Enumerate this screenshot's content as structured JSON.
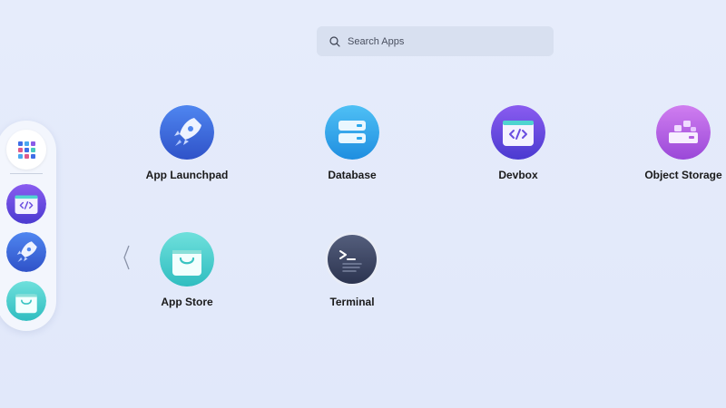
{
  "search": {
    "placeholder": "Search Apps",
    "icon": "search-icon"
  },
  "dock": {
    "items": [
      {
        "name": "all-apps",
        "icon": "grid-icon"
      },
      {
        "name": "Devbox",
        "icon": "devbox-icon"
      },
      {
        "name": "App Launchpad",
        "icon": "rocket-icon"
      },
      {
        "name": "App Store",
        "icon": "shopping-bag-icon"
      }
    ]
  },
  "apps": [
    {
      "label": "App Launchpad",
      "icon": "rocket-icon"
    },
    {
      "label": "Database",
      "icon": "database-icon"
    },
    {
      "label": "Devbox",
      "icon": "devbox-icon"
    },
    {
      "label": "Object Storage",
      "icon": "object-storage-icon"
    },
    {
      "label": "App Store",
      "icon": "shopping-bag-icon"
    },
    {
      "label": "Terminal",
      "icon": "terminal-icon"
    }
  ],
  "colors": {
    "background": "#e3e9fa",
    "search_bg": "#d8e0f0",
    "launchpad": "#3f6ee6",
    "database": "#2aa7ec",
    "devbox": "#6a4ee0",
    "object_storage": "#b45fe0",
    "app_store": "#4fd4d0",
    "terminal": "#3c4560"
  }
}
